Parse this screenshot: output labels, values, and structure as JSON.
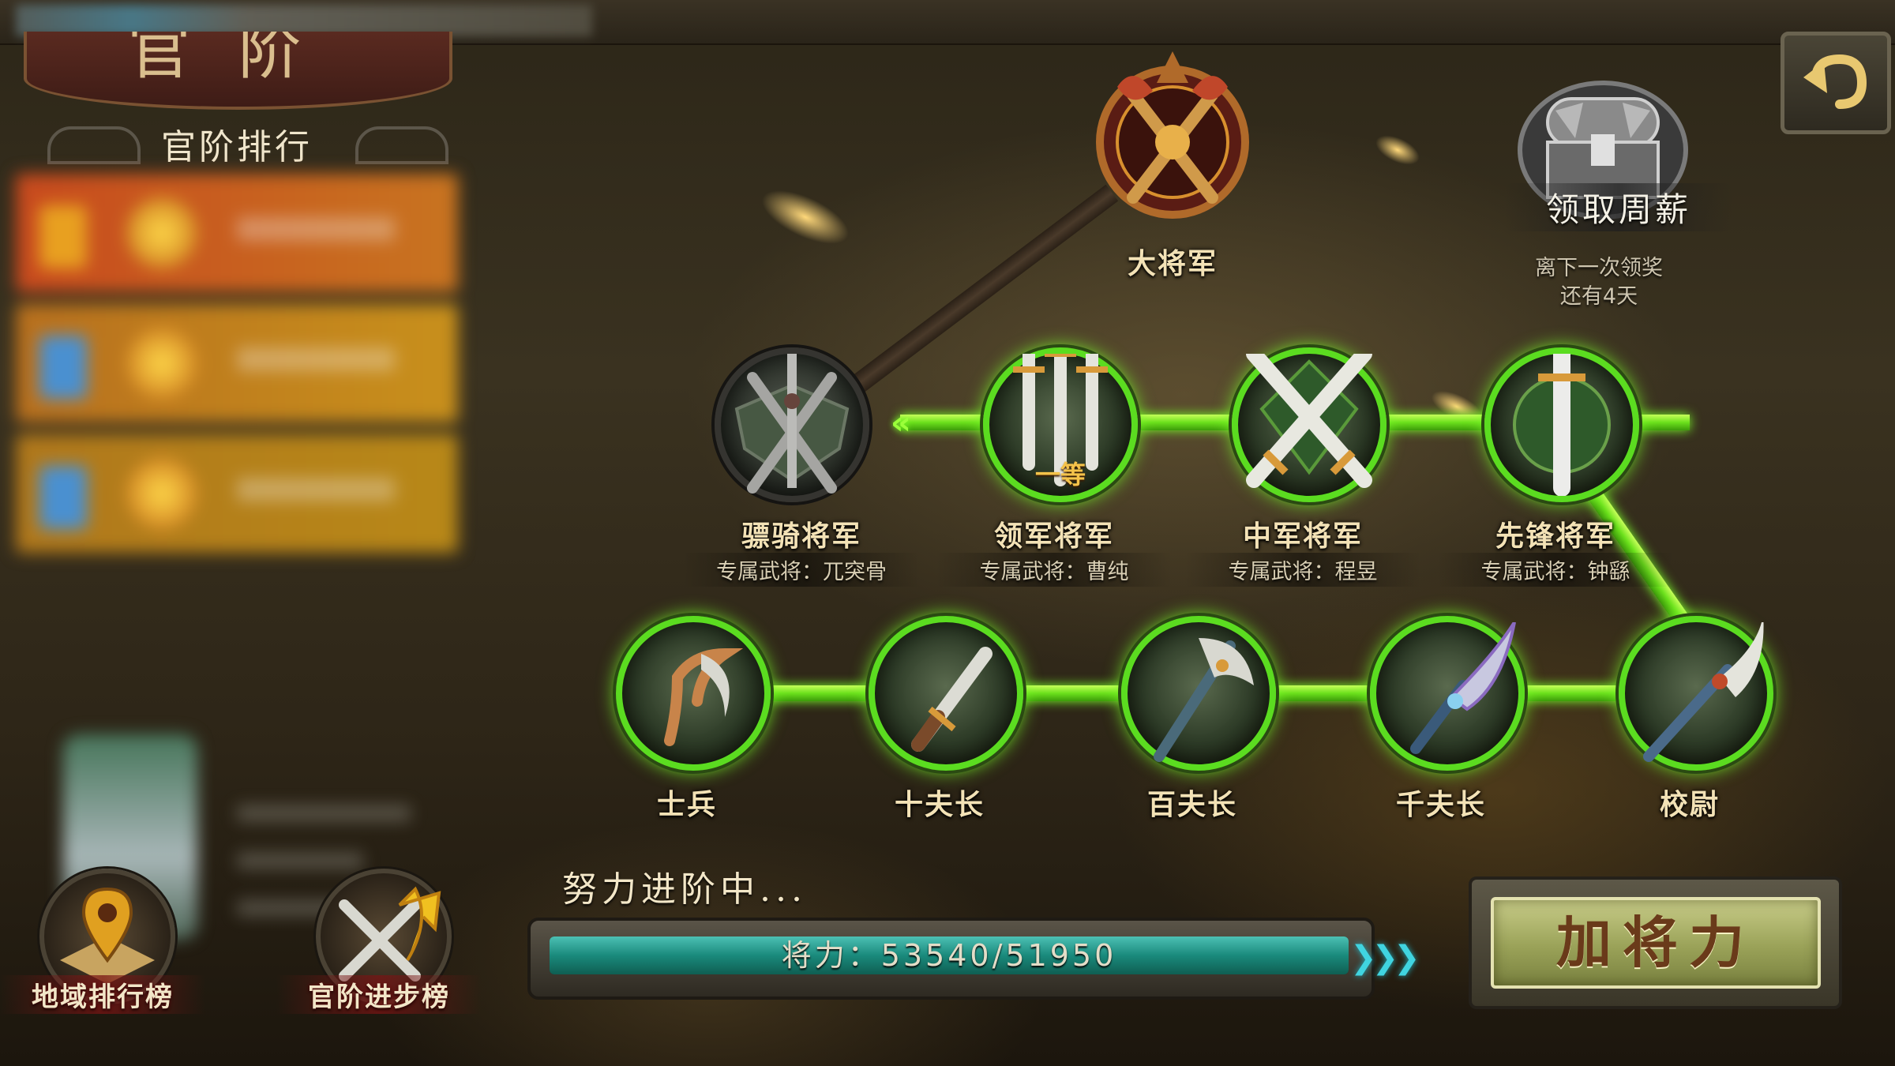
{
  "banner": {
    "title": "官阶"
  },
  "rank_panel": {
    "title": "官阶排行"
  },
  "top_rank": {
    "label": "大将军",
    "icon": "crossed-axes-emblem-icon"
  },
  "weekly_reward": {
    "label": "领取周薪",
    "note_line1": "离下一次领奖",
    "note_line2": "还有4天",
    "icon": "treasure-chest-icon"
  },
  "generals": [
    {
      "label": "骠骑将军",
      "sub": "专属武将：兀突骨",
      "icon": "twin-swords-shield-icon",
      "state": "dim"
    },
    {
      "label": "领军将军",
      "sub": "专属武将：曹纯",
      "icon": "triple-swords-icon",
      "badge": "一等",
      "state": "lit"
    },
    {
      "label": "中军将军",
      "sub": "专属武将：程昱",
      "icon": "crossed-swords-icon",
      "state": "lit"
    },
    {
      "label": "先锋将军",
      "sub": "专属武将：钟繇",
      "icon": "single-sword-icon",
      "state": "lit"
    }
  ],
  "soldiers": [
    {
      "label": "士兵",
      "icon": "sickle-icon"
    },
    {
      "label": "十夫长",
      "icon": "dagger-icon"
    },
    {
      "label": "百夫长",
      "icon": "axe-icon"
    },
    {
      "label": "千夫长",
      "icon": "broadsword-icon"
    },
    {
      "label": "校尉",
      "icon": "glaive-icon"
    }
  ],
  "buttons": {
    "region_rank": "地域排行榜",
    "progress_rank": "官阶进步榜",
    "add_power": "加将力"
  },
  "progress": {
    "caption": "努力进阶中...",
    "text": "将力：53540/51950",
    "current": 53540,
    "target": 51950,
    "fill_fraction": 1.0
  },
  "colors": {
    "link_green": "#6be01c",
    "progress_teal": "#1a8a7c",
    "label_gold": "#f3e2b6"
  }
}
